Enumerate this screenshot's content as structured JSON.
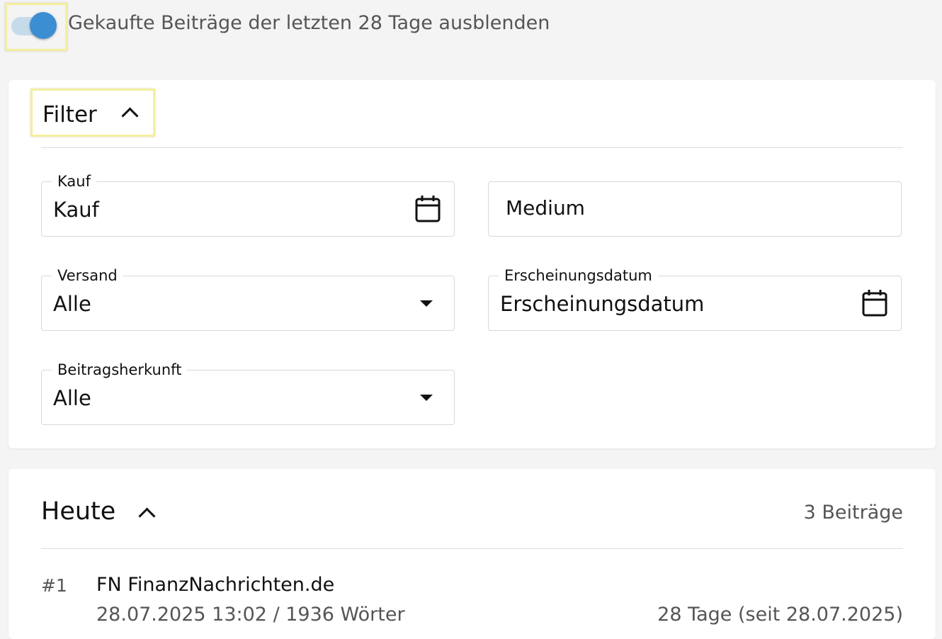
{
  "toggle": {
    "label": "Gekaufte Beiträge der letzten 28 Tage ausblenden",
    "checked": true,
    "color": "#3c8ed3"
  },
  "filter": {
    "title": "Filter",
    "fields": {
      "kauf": {
        "label": "Kauf",
        "value": "Kauf",
        "icon": "calendar-icon"
      },
      "medium": {
        "placeholder": "Medium"
      },
      "versand": {
        "label": "Versand",
        "value": "Alle",
        "icon": "caret-down-icon"
      },
      "erscheinungsdatum": {
        "label": "Erscheinungsdatum",
        "value": "Erscheinungsdatum",
        "icon": "calendar-icon"
      },
      "beitragsherkunft": {
        "label": "Beitragsherkunft",
        "value": "Alle",
        "icon": "caret-down-icon"
      }
    }
  },
  "list": {
    "title": "Heute",
    "count": "3 Beiträge",
    "items": [
      {
        "number": "#1",
        "source": "FN FinanzNachrichten.de",
        "meta": "28.07.2025 13:02 / 1936 Wörter",
        "period": "28 Tage (seit 28.07.2025)"
      }
    ]
  },
  "colors": {
    "highlight": "#f4ef9c",
    "background": "#f4f4f4"
  }
}
